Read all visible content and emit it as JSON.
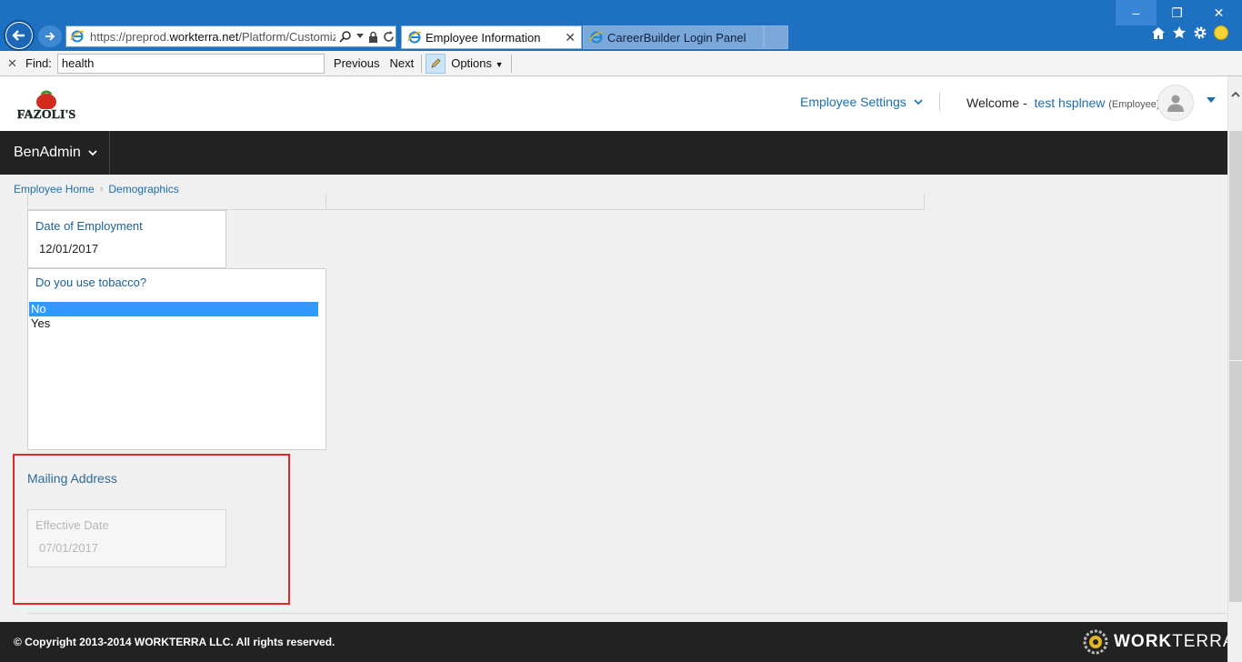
{
  "browser": {
    "url_prefix": "https://preprod.",
    "url_host": "workterra.net",
    "url_path": "/Platform/Customizat",
    "tabs": [
      {
        "label": "Employee Information",
        "active": true
      },
      {
        "label": "CareerBuilder Login Panel",
        "active": false
      }
    ],
    "window_controls": {
      "minimize": "–",
      "restore": "❐",
      "close": "✕"
    }
  },
  "find_bar": {
    "label": "Find:",
    "query": "health",
    "previous_label": "Previous",
    "next_label": "Next",
    "options_label": "Options"
  },
  "header": {
    "logo_text": "FAZOLI'S",
    "employee_settings_label": "Employee Settings",
    "welcome_prefix": "Welcome -",
    "user_name": "test hsplnew",
    "user_role": "(Employee)"
  },
  "nav": {
    "menu_label": "BenAdmin"
  },
  "breadcrumb": {
    "items": [
      "Employee Home",
      "Demographics"
    ]
  },
  "form": {
    "date_of_employment": {
      "label": "Date of Employment",
      "value": "12/01/2017"
    },
    "tobacco": {
      "label": "Do you use tobacco?",
      "options": [
        "No",
        "Yes"
      ],
      "selected": "No"
    },
    "mailing_address": {
      "title": "Mailing Address",
      "effective_date": {
        "label": "Effective Date",
        "value": "07/01/2017"
      }
    }
  },
  "footer": {
    "copyright": "© Copyright 2013-2014 WORKTERRA LLC. All rights reserved.",
    "brand_bold": "WORK",
    "brand_light": "TERRA"
  },
  "colors": {
    "chrome_blue": "#1e70c1",
    "link_blue": "#1a6fb0",
    "nav_dark": "#222222",
    "highlight_red": "#e02a2a",
    "selection_blue": "#3399ff"
  }
}
